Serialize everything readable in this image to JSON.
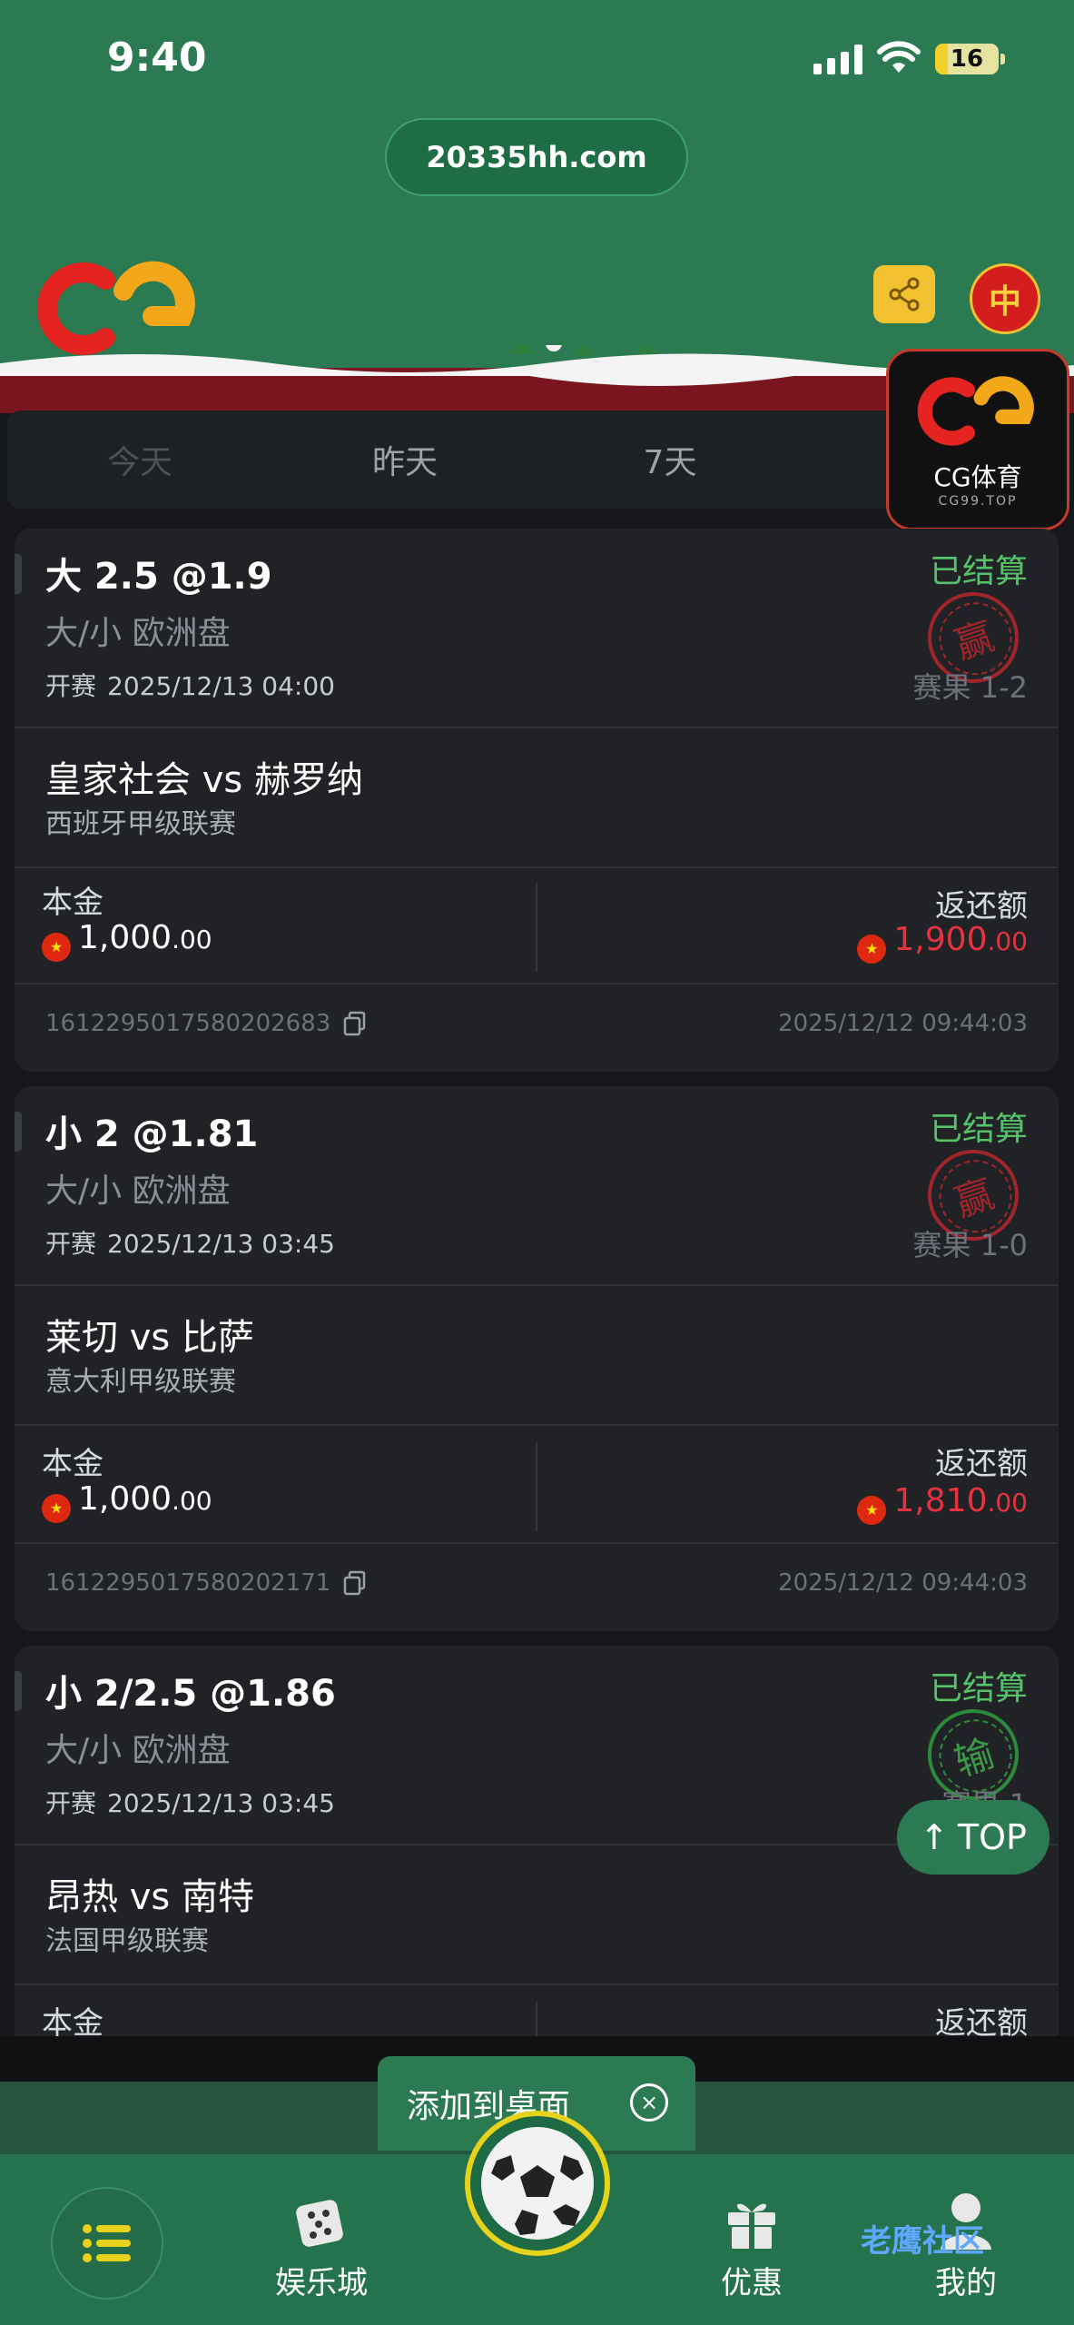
{
  "status_bar": {
    "time": "9:40",
    "battery": "16"
  },
  "url": "20335hh.com",
  "header": {
    "lang": "中"
  },
  "tabs": [
    "今天",
    "昨天",
    "7天"
  ],
  "float_logo": {
    "name": "CG体育",
    "domain": "CG99.TOP"
  },
  "cards": [
    {
      "title": "大 2.5 @1.9",
      "status": "已结算",
      "market": "大/小 欧洲盘",
      "start_label": "开赛",
      "start_time": "2025/12/13 04:00",
      "result_label": "赛果",
      "result": "1-2",
      "stamp": "赢",
      "teams": "皇家社会 vs 赫罗纳",
      "league": "西班牙甲级联赛",
      "principal_label": "本金",
      "principal_int": "1,000",
      "principal_dec": ".00",
      "return_label": "返还额",
      "return_int": "1,900",
      "return_dec": ".00",
      "order_id": "1612295017580202683",
      "order_time": "2025/12/12 09:44:03"
    },
    {
      "title": "小 2 @1.81",
      "status": "已结算",
      "market": "大/小 欧洲盘",
      "start_label": "开赛",
      "start_time": "2025/12/13 03:45",
      "result_label": "赛果",
      "result": "1-0",
      "stamp": "赢",
      "teams": "莱切 vs 比萨",
      "league": "意大利甲级联赛",
      "principal_label": "本金",
      "principal_int": "1,000",
      "principal_dec": ".00",
      "return_label": "返还额",
      "return_int": "1,810",
      "return_dec": ".00",
      "order_id": "1612295017580202171",
      "order_time": "2025/12/12 09:44:03"
    },
    {
      "title": "小 2/2.5 @1.86",
      "status": "已结算",
      "market": "大/小 欧洲盘",
      "start_label": "开赛",
      "start_time": "2025/12/13 03:45",
      "result_label": "赛果",
      "result": "1",
      "stamp": "输",
      "teams": "昂热 vs 南特",
      "league": "法国甲级联赛",
      "principal_label": "本金",
      "return_label": "返还额"
    }
  ],
  "top_button": "TOP",
  "add_to_desktop": "添加到桌面",
  "nav": {
    "casino": "娱乐城",
    "promo": "优惠",
    "me": "我的"
  },
  "watermark": "老鹰社区",
  "colors": {
    "brand_green": "#2b7a52",
    "win_green": "#55c26b",
    "return_red": "#e5323f",
    "stamp_red": "#b6262b"
  }
}
